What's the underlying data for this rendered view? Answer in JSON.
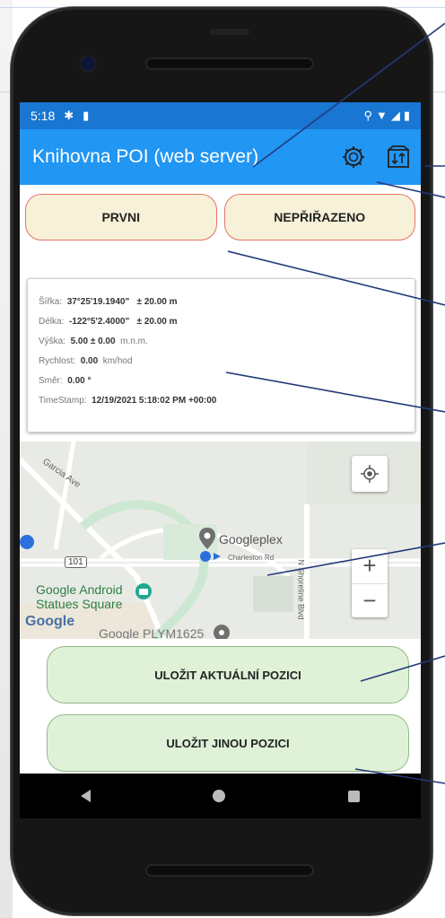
{
  "status": {
    "time": "5:18"
  },
  "appbar": {
    "title": "Knihovna POI (web server)",
    "settings_icon": "gear-icon",
    "import_icon": "import-export-icon"
  },
  "tabs": [
    {
      "label": "PRVNI"
    },
    {
      "label": "NEPŘIŘAZENO"
    }
  ],
  "info": {
    "lat_label": "Šířka:",
    "lat_value": "37°25'19.1940\"",
    "lat_acc": "± 20.00 m",
    "lon_label": "Délka:",
    "lon_value": "-122°5'2.4000\"",
    "lon_acc": "± 20.00 m",
    "alt_label": "Výška:",
    "alt_value": "5.00 ± 0.00",
    "alt_unit": "m.n.m.",
    "speed_label": "Rychlost:",
    "speed_value": "0.00",
    "speed_unit": "km/hod",
    "dir_label": "Směr:",
    "dir_value": "0.00 °",
    "ts_label": "TimeStamp:",
    "ts_value": "12/19/2021 5:18:02 PM +00:00"
  },
  "map": {
    "labels": {
      "garcia": "Garcia Ave",
      "googleplex": "Googleplex",
      "charleston": "Charleston Rd",
      "shoreline": "N Shoreline Blvd",
      "route": "101",
      "android1": "Google Android",
      "android2": "Statues Square",
      "plym": "Google PLYM1625",
      "logo": "Google"
    },
    "zoom_in": "+",
    "zoom_out": "−"
  },
  "buttons": {
    "save_current": "ULOŽIT AKTUÁLNÍ POZICI",
    "save_other": "ULOŽIT JINOU POZICI"
  },
  "colors": {
    "appbar": "#2196f3",
    "statusbar": "#1976d2",
    "tab_bg": "#f6f1d8",
    "tab_border": "#e57368",
    "save_bg": "#dff2d8",
    "annotation_line": "#233a7a"
  }
}
